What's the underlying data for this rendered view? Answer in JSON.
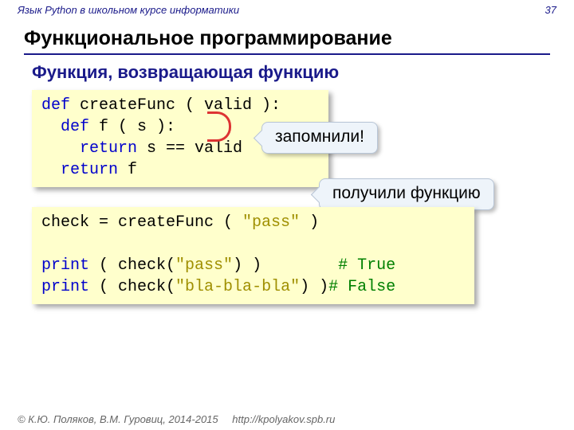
{
  "header": {
    "tagline": "Язык Python в школьном курсе информатики",
    "page_no": "37"
  },
  "title": "Функциональное программирование",
  "subtitle": "Функция, возвращающая функцию",
  "code1": {
    "l1a": "def",
    "l1b": " createFunc ( valid ):",
    "l2a": "  def",
    "l2b": " f ( s ):",
    "l3a": "    return",
    "l3b": " s == valid",
    "l4a": "  return",
    "l4b": " f"
  },
  "code2": {
    "l1a": "check = createFunc ( ",
    "l1s": "\"pass\"",
    "l1b": " )",
    "l2a": "print",
    "l2b": " ( check(",
    "l2s": "\"pass\"",
    "l2c": ") )        ",
    "l2cm": "# True",
    "l3a": "print",
    "l3b": " ( check(",
    "l3s": "\"bla-bla-bla\"",
    "l3c": ") )",
    "l3cm": "# False"
  },
  "callouts": {
    "c1": "запомнили!",
    "c2": "получили функцию"
  },
  "footer": {
    "copy": "© К.Ю. Поляков, В.М. Гуровиц, 2014-2015",
    "url": "http://kpolyakov.spb.ru"
  }
}
